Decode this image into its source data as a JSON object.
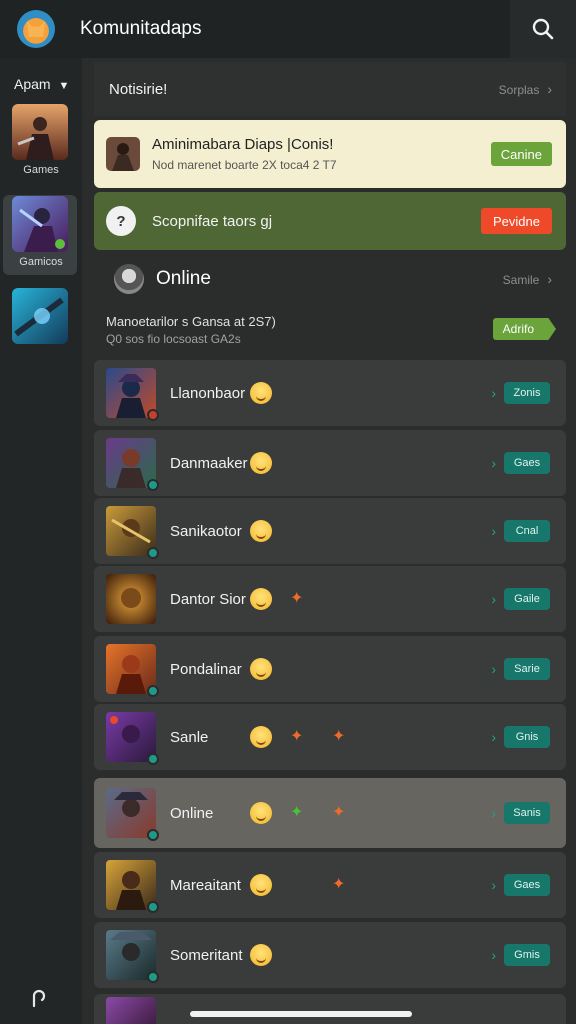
{
  "app": {
    "title": "Komunitadaps",
    "logo_icon": "fox-logo-icon"
  },
  "rail": {
    "header": "Apam",
    "items": [
      {
        "label": ""
      },
      {
        "label": "Games"
      },
      {
        "label": "Gamicos"
      },
      {
        "label": ""
      }
    ]
  },
  "notifications": {
    "title": "Notisirie!",
    "link": "Sorplas",
    "featured": {
      "title": "Aminimabara Diaps |Conis!",
      "subtitle": "Nod marenet boarte 2X toca4 2 T7",
      "button": "Canine"
    },
    "prompt": {
      "text": "Scopnifae taors gj",
      "button": "Pevidne"
    }
  },
  "online": {
    "title": "Online",
    "link": "Samile",
    "promo": {
      "line1": "Manoetarilor s Gansa at 2S7)",
      "line2": "Q0 sos fio locsoast GA2s",
      "button": "Adrifo"
    },
    "rows": [
      {
        "name": "Llanonbaor",
        "button": "Zonis"
      },
      {
        "name": "Danmaaker",
        "button": "Gaes"
      },
      {
        "name": "Sanikaotor",
        "button": "Cnal"
      },
      {
        "name": "Dantor Sior",
        "button": "Gaile"
      },
      {
        "name": "Pondalinar",
        "button": "Sarie"
      },
      {
        "name": "Sanle",
        "button": "Gnis"
      },
      {
        "name": "Online",
        "button": "Sanis"
      },
      {
        "name": "Mareaitant",
        "button": "Gaes"
      },
      {
        "name": "Someritant",
        "button": "Gmis"
      }
    ]
  },
  "colors": {
    "accent_green": "#6aa43b",
    "accent_red": "#ee4a2a",
    "teal": "#17776a",
    "card_yellow": "#f4efd0",
    "card_olive": "#4f6735"
  }
}
